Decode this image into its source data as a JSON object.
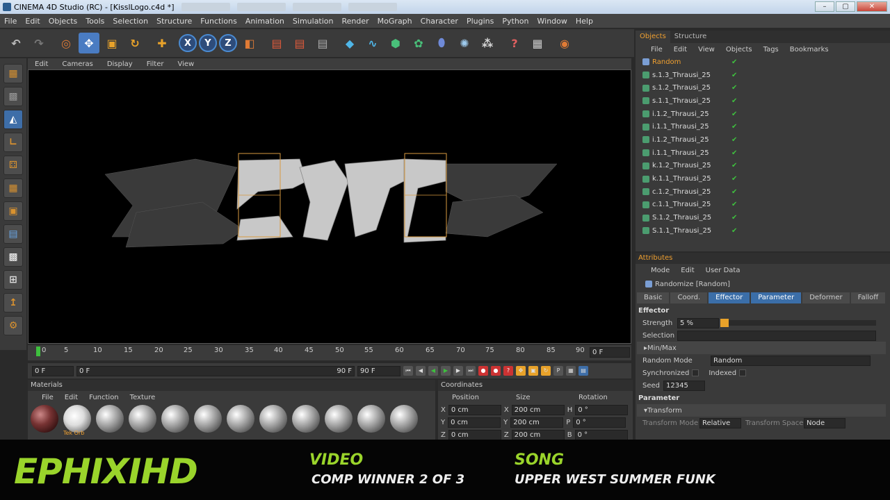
{
  "window": {
    "title": "CINEMA 4D Studio (RC) - [KisslLogo.c4d *]",
    "min": "–",
    "max": "▢",
    "close": "✕"
  },
  "menubar": [
    "File",
    "Edit",
    "Objects",
    "Tools",
    "Selection",
    "Structure",
    "Functions",
    "Animation",
    "Simulation",
    "Render",
    "MoGraph",
    "Character",
    "Plugins",
    "Python",
    "Window",
    "Help"
  ],
  "viewport_menu": [
    "Edit",
    "Cameras",
    "Display",
    "Filter",
    "View"
  ],
  "timeline": {
    "ticks": [
      "0",
      "5",
      "10",
      "15",
      "20",
      "25",
      "30",
      "35",
      "40",
      "45",
      "50",
      "55",
      "60",
      "65",
      "70",
      "75",
      "80",
      "85",
      "90"
    ],
    "current": "0 F"
  },
  "transport": {
    "start": "0 F",
    "range_start": "0 F",
    "range_end": "90 F",
    "end": "90 F"
  },
  "materials": {
    "title": "Materials",
    "menu": [
      "File",
      "Edit",
      "Function",
      "Texture"
    ],
    "labels": [
      "",
      "Tek Orb",
      "",
      "",
      "",
      "",
      "",
      "",
      "",
      "",
      "",
      "",
      ""
    ]
  },
  "coordinates": {
    "title": "Coordinates",
    "headers": [
      "Position",
      "Size",
      "Rotation"
    ],
    "rows": [
      {
        "axis": "X",
        "pos": "0 cm",
        "size_axis": "X",
        "size": "200 cm",
        "rot_axis": "H",
        "rot": "0 °"
      },
      {
        "axis": "Y",
        "pos": "0 cm",
        "size_axis": "Y",
        "size": "200 cm",
        "rot_axis": "P",
        "rot": "0 °"
      },
      {
        "axis": "Z",
        "pos": "0 cm",
        "size_axis": "Z",
        "size": "200 cm",
        "rot_axis": "B",
        "rot": "0 °"
      }
    ]
  },
  "objects_panel": {
    "tabs": [
      "Objects",
      "Structure"
    ],
    "menu": [
      "File",
      "Edit",
      "View",
      "Objects",
      "Tags",
      "Bookmarks"
    ],
    "items": [
      "Random",
      "s.1.3_Thrausi_25",
      "s.1.2_Thrausi_25",
      "s.1.1_Thrausi_25",
      "i.1.2_Thrausi_25",
      "i.1.1_Thrausi_25",
      "i.1.2_Thrausi_25",
      "i.1.1_Thrausi_25",
      "k.1.2_Thrausi_25",
      "k.1.1_Thrausi_25",
      "c.1.2_Thrausi_25",
      "c.1.1_Thrausi_25",
      "S.1.2_Thrausi_25",
      "S.1.1_Thrausi_25"
    ]
  },
  "attributes": {
    "title": "Attributes",
    "menu": [
      "Mode",
      "Edit",
      "User Data"
    ],
    "object_name": "Randomize [Random]",
    "tabs": [
      "Basic",
      "Coord.",
      "Effector",
      "Parameter",
      "Deformer",
      "Falloff"
    ],
    "active_tabs": [
      "Effector",
      "Parameter"
    ],
    "effector_heading": "Effector",
    "strength_label": "Strength",
    "strength_value": "5 %",
    "selection_label": "Selection",
    "minmax_label": "Min/Max",
    "random_mode_label": "Random Mode",
    "random_mode_value": "Random",
    "synchronized_label": "Synchronized",
    "indexed_label": "Indexed",
    "seed_label": "Seed",
    "seed_value": "12345",
    "parameter_heading": "Parameter",
    "transform_label": "Transform",
    "transform_mode_label": "Transform Mode",
    "transform_mode_value": "Relative",
    "transform_space_label": "Transform Space",
    "transform_space_value": "Node"
  },
  "overlay": {
    "channel": "EPHIXIHD",
    "video_head": "VIDEO",
    "video_sub": "COMP WINNER 2 OF 3",
    "song_head": "SONG",
    "song_sub": "UPPER WEST   SUMMER FUNK"
  }
}
